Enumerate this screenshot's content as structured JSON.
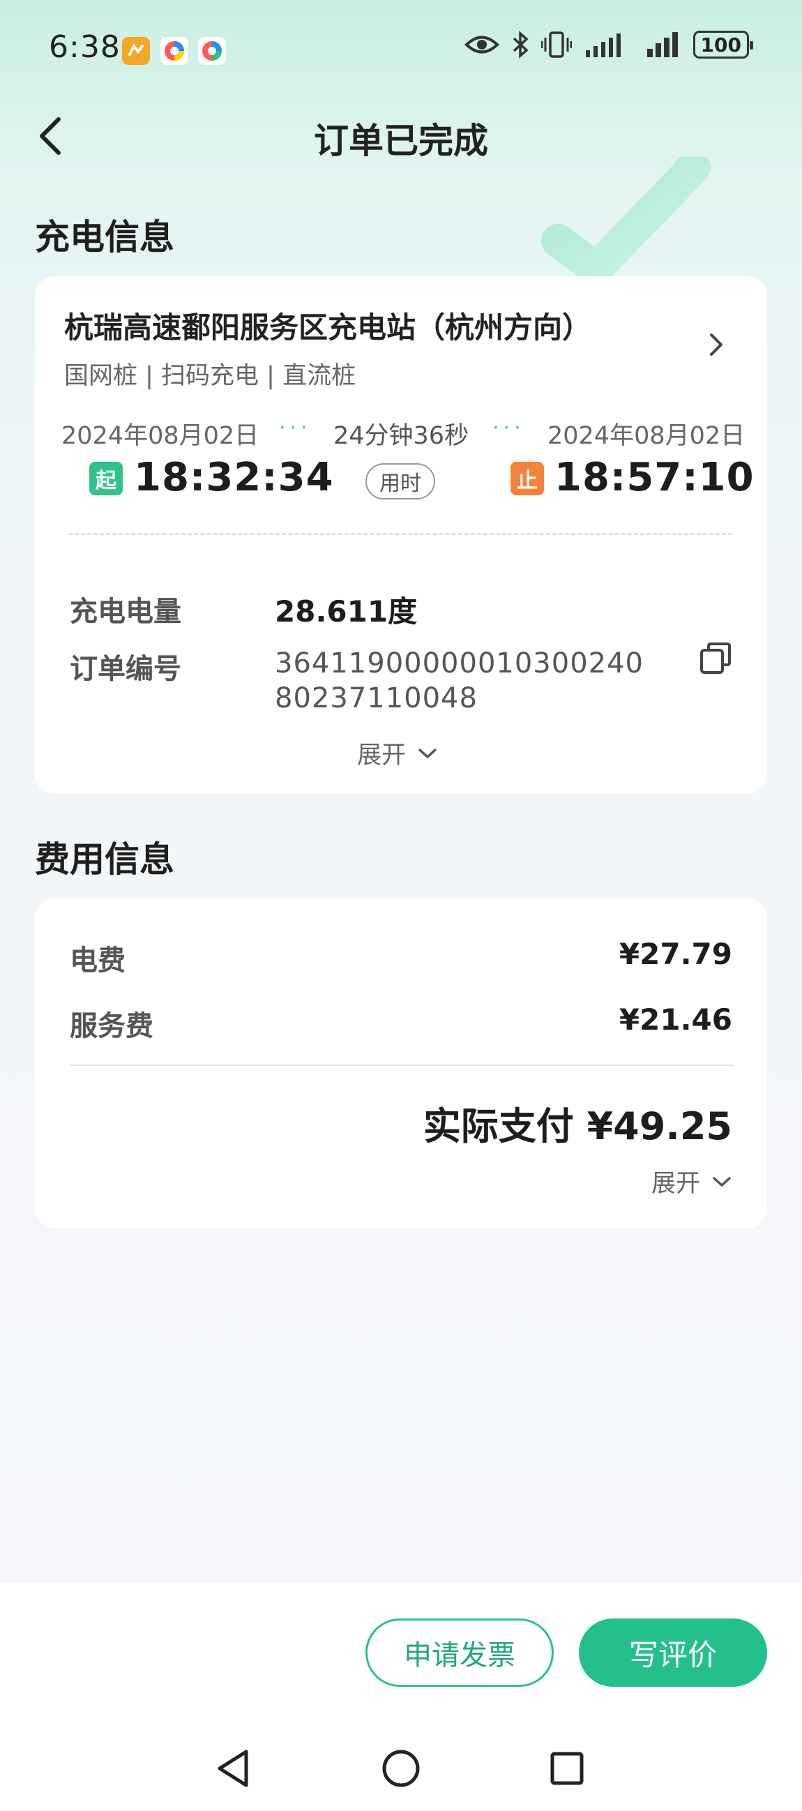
{
  "status_bar": {
    "time": "6:38",
    "battery": "100"
  },
  "header": {
    "title": "订单已完成"
  },
  "charging_info": {
    "section_title": "充电信息",
    "station_name": "杭瑞高速鄱阳服务区充电站（杭州方向）",
    "station_tags": "国网桩 | 扫码充电 | 直流桩",
    "start": {
      "date": "2024年08月02日",
      "badge": "起",
      "time": "18:32:34"
    },
    "duration": {
      "text": "24分钟36秒",
      "pill": "用时"
    },
    "end": {
      "date": "2024年08月02日",
      "badge": "止",
      "time": "18:57:10"
    },
    "energy_label": "充电电量",
    "energy_value": "28.611度",
    "order_label": "订单编号",
    "order_line1": "36411900000010300240",
    "order_line2": "80237110048",
    "expand_label": "展开"
  },
  "fee_info": {
    "section_title": "费用信息",
    "electricity_label": "电费",
    "electricity_value": "¥27.79",
    "service_label": "服务费",
    "service_value": "¥21.46",
    "total_text": "实际支付 ¥49.25",
    "expand_label": "展开"
  },
  "actions": {
    "invoice_label": "申请发票",
    "review_label": "写评价"
  },
  "colors": {
    "accent": "#24c08a",
    "start_badge": "#2fc28a",
    "end_badge": "#f5823a"
  }
}
